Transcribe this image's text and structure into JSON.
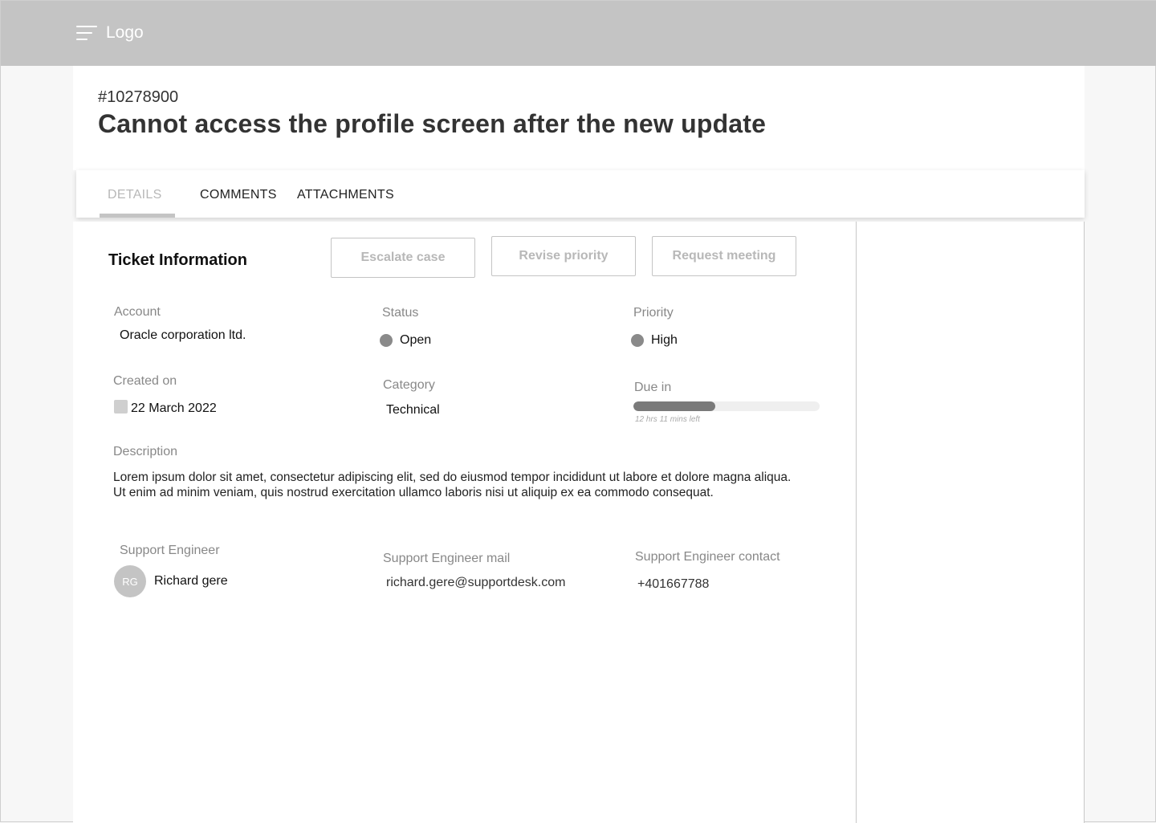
{
  "topbar": {
    "logo": "Logo",
    "menu_icon": "hamburger-menu-icon"
  },
  "ticket": {
    "id": "#10278900",
    "title": "Cannot access the profile screen after the new update"
  },
  "tabs": [
    {
      "label": "DETAILS",
      "active": true
    },
    {
      "label": "COMMENTS",
      "active": false
    },
    {
      "label": "ATTACHMENTS",
      "active": false
    }
  ],
  "section": {
    "title": "Ticket Information"
  },
  "actions": {
    "escalate": "Escalate case",
    "revise": "Revise priority",
    "meeting": "Request meeting"
  },
  "fields": {
    "account": {
      "label": "Account",
      "value": "Oracle corporation ltd."
    },
    "status": {
      "label": "Status",
      "value": "Open"
    },
    "priority": {
      "label": "Priority",
      "value": "High"
    },
    "created": {
      "label": "Created on",
      "value": "22 March 2022",
      "icon": "calendar-icon"
    },
    "category": {
      "label": "Category",
      "value": "Technical"
    },
    "due": {
      "label": "Due in",
      "note": "12 hrs 11 mins left",
      "progress": 0.44
    },
    "description": {
      "label": "Description",
      "value": "Lorem ipsum dolor sit amet, consectetur adipiscing elit, sed do eiusmod tempor incididunt ut labore et dolore magna aliqua. Ut enim ad minim veniam, quis nostrud exercitation ullamco laboris nisi ut aliquip ex ea commodo consequat."
    },
    "engineer": {
      "label": "Support Engineer",
      "initials": "RG",
      "name": "Richard gere"
    },
    "engineer_mail": {
      "label": "Support Engineer mail",
      "value": "richard.gere@supportdesk.com"
    },
    "engineer_contact": {
      "label": "Support Engineer contact",
      "value": "+401667788"
    }
  },
  "colors": {
    "topbar": "#c4c4c4",
    "status_dot": "#8a8a8a",
    "progress_fill": "#7a7a7a"
  }
}
